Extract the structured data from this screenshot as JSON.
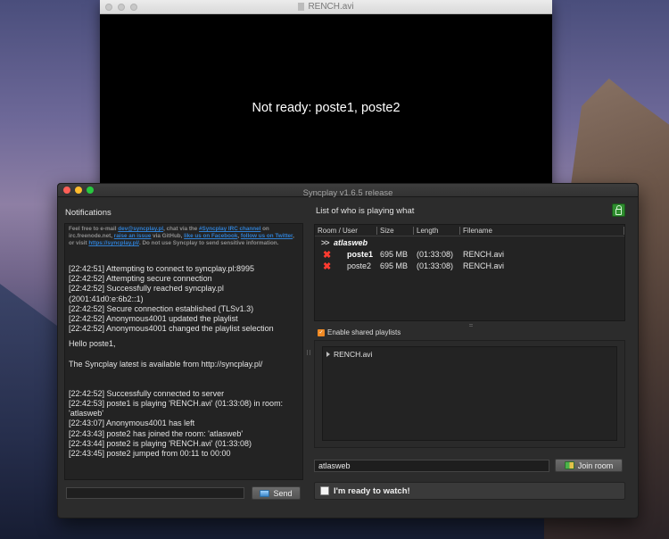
{
  "video": {
    "title": "RENCH.avi",
    "status": "Not ready: poste1, poste2"
  },
  "syncplay": {
    "title": "Syncplay v1.6.5 release",
    "notifications": {
      "label": "Notifications",
      "intro_parts": [
        {
          "text": "Feel free to e-mail ",
          "link": false
        },
        {
          "text": "dev@syncplay.pl",
          "link": true
        },
        {
          "text": ", chat via the ",
          "link": false
        },
        {
          "text": "#Syncplay IRC channel",
          "link": true
        },
        {
          "text": " on irc.freenode.net, ",
          "link": false
        },
        {
          "text": "raise an issue",
          "link": true
        },
        {
          "text": " via GitHub, ",
          "link": false
        },
        {
          "text": "like us on Facebook",
          "link": true
        },
        {
          "text": ", ",
          "link": false
        },
        {
          "text": "follow us on Twitter",
          "link": true
        },
        {
          "text": ", or visit ",
          "link": false
        },
        {
          "text": "https://syncplay.pl/",
          "link": true
        },
        {
          "text": ". Do not use Syncplay to send sensitive information.",
          "link": false
        }
      ],
      "log_block_1": [
        "[22:42:51] Attempting to connect to syncplay.pl:8995",
        "[22:42:52] Attempting secure connection",
        "[22:42:52] Successfully reached syncplay.pl (2001:41d0:e:6b2::1)",
        "[22:42:52] Secure connection established (TLSv1.3)",
        "[22:42:52] Anonymous4001 updated the playlist",
        "[22:42:52] Anonymous4001 changed the playlist selection"
      ],
      "greeting": "Hello poste1,",
      "latest": "The Syncplay latest is available from http://syncplay.pl/",
      "log_block_2": [
        "[22:42:52] Successfully connected to server",
        "[22:42:53] poste1 is playing 'RENCH.avi' (01:33:08) in room: 'atlasweb'",
        "[22:43:07] Anonymous4001 has left",
        "[22:43:43] poste2 has joined the room: 'atlasweb'",
        "[22:43:44] poste2 is playing 'RENCH.avi' (01:33:08)",
        "[22:43:45] poste2 jumped from 00:11 to 00:00"
      ],
      "chat_input_value": "",
      "send_label": "Send"
    },
    "users": {
      "label": "List of who is playing what",
      "columns": [
        "Room / User",
        "Size",
        "Length",
        "Filename"
      ],
      "room": "atlasweb",
      "rows": [
        {
          "user": "poste1",
          "size": "695 MB",
          "length": "(01:33:08)",
          "filename": "RENCH.avi",
          "status_icon": "not-ready-x-icon"
        },
        {
          "user": "poste2",
          "size": "695 MB",
          "length": "(01:33:08)",
          "filename": "RENCH.avi",
          "status_icon": "not-ready-x-icon"
        }
      ]
    },
    "shared_playlists": {
      "label": "Enable shared playlists",
      "checked": true,
      "items": [
        "RENCH.avi"
      ]
    },
    "room_input_value": "atlasweb",
    "join_label": "Join room",
    "ready_label": "I'm ready to watch!"
  }
}
